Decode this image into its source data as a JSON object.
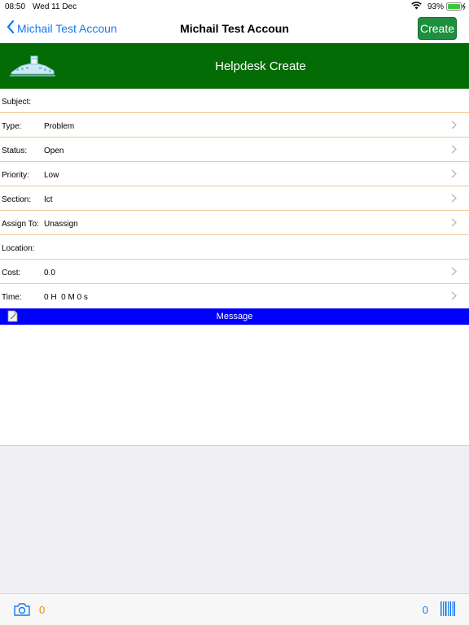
{
  "status_bar": {
    "time": "08:50",
    "date": "Wed 11 Dec",
    "battery": "93%"
  },
  "nav": {
    "back_label": "Michail Test Accoun",
    "title": "Michail Test Accoun",
    "create_label": "Create"
  },
  "banner": {
    "title": "Helpdesk Create"
  },
  "form": {
    "subject": {
      "label": "Subject:",
      "value": ""
    },
    "type": {
      "label": "Type:",
      "value": "Problem"
    },
    "status": {
      "label": "Status:",
      "value": "Open"
    },
    "priority": {
      "label": "Priority:",
      "value": "Low"
    },
    "section": {
      "label": "Section:",
      "value": "Ict"
    },
    "assign_to": {
      "label": "Assign To:",
      "value": "Unassign"
    },
    "location": {
      "label": "Location:",
      "value": ""
    },
    "cost": {
      "label": "Cost:",
      "value": "0.0"
    },
    "time": {
      "label": "Time:",
      "value": "0 H  0 M 0 s"
    }
  },
  "message": {
    "label": "Message",
    "value": ""
  },
  "toolbar": {
    "photo_count": "0",
    "barcode_count": "0"
  },
  "colors": {
    "banner": "#056b05",
    "message_bar": "#0000ff",
    "accent": "#1478f0",
    "create_button": "#1d8f3e",
    "row_divider": "#f3c99a"
  }
}
